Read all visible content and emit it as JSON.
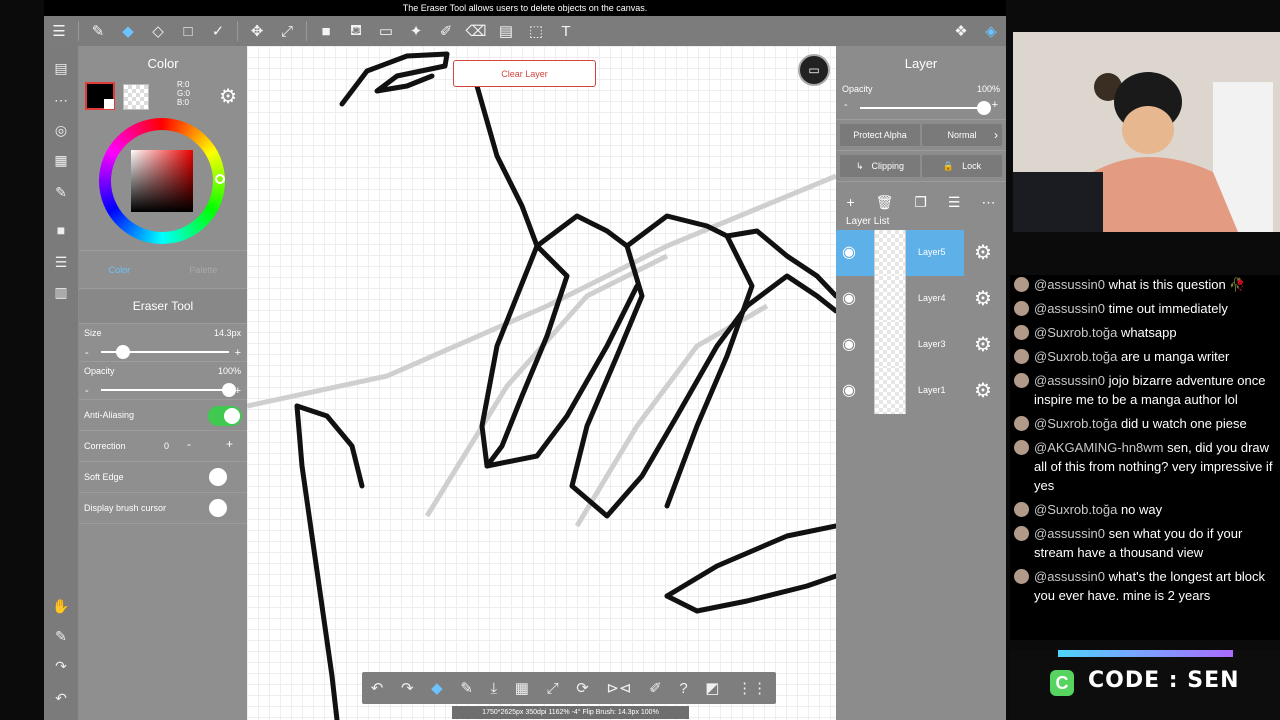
{
  "tooltip": "The Eraser Tool allows users to delete objects on the canvas.",
  "toolbar_top": {
    "left_icons": [
      "menu-icon",
      "brush-icon",
      "eraser-icon",
      "fill-eraser-icon",
      "shape-icon",
      "select-icon"
    ],
    "right_icons": [
      "move-icon",
      "transform-icon",
      "color-square-icon",
      "fill-bucket-icon",
      "gradient-icon",
      "magic-wand-icon",
      "pen-select-icon",
      "eraser-select-icon",
      "layout-icon",
      "lasso-icon",
      "text-icon",
      "materials-icon",
      "layers-icon"
    ],
    "glyphs": {
      "menu": "☰",
      "brush": "✎",
      "eraser": "◆",
      "fill_eraser": "◇",
      "shape": "□",
      "select": "✓",
      "move": "✥",
      "transform": "⤢",
      "color_square": "■",
      "fill": "⛾",
      "gradient": "▭",
      "wand": "✦",
      "pen_select": "✐",
      "eraser_select": "⌫",
      "layout": "▤",
      "lasso": "⬚",
      "text": "T",
      "materials": "❖",
      "layers": "◈"
    }
  },
  "tool_column": {
    "glyphs": [
      "▤",
      "⋯",
      "◎",
      "▦",
      "✎",
      "■",
      "☰",
      "▥",
      "✋",
      "✎",
      "↷",
      "↶"
    ]
  },
  "color_panel": {
    "title": "Color",
    "rgb_r": "R:0",
    "rgb_g": "G:0",
    "rgb_b": "B:0",
    "tab_color": "Color",
    "tab_palette": "Palette",
    "colors": {
      "main": "#000000",
      "sub": "#ffffff",
      "hue": "#ee0000"
    }
  },
  "eraser_panel": {
    "title": "Eraser Tool",
    "size_label": "Size",
    "size_value": "14.3px",
    "size_level": 0.17,
    "opacity_label": "Opacity",
    "opacity_value": "100%",
    "opacity_level": 1.0,
    "anti_aliasing_label": "Anti-Aliasing",
    "anti_aliasing_on": true,
    "correction_label": "Correction",
    "correction_value": "0",
    "soft_edge_label": "Soft Edge",
    "display_cursor_label": "Display brush cursor",
    "minus": "-",
    "plus": "+"
  },
  "canvas": {
    "clear_layer_label": "Clear Layer"
  },
  "layer_panel": {
    "title": "Layer",
    "opacity_label": "Opacity",
    "opacity_value": "100%",
    "opacity_level": 1.0,
    "protect_alpha_label": "Protect Alpha",
    "blend_label": "Normal",
    "clipping_label": "Clipping",
    "lock_label": "Lock",
    "list_title": "Layer List",
    "layers": [
      {
        "name": "Layer5",
        "selected": true
      },
      {
        "name": "Layer4",
        "selected": false
      },
      {
        "name": "Layer3",
        "selected": false
      },
      {
        "name": "Layer1",
        "selected": false
      }
    ],
    "accent": "#5eb0e8"
  },
  "bottom_bar": {
    "glyphs": [
      "↶",
      "↷",
      "◆",
      "✎",
      "⤓",
      "▦",
      "⤢",
      "⟳",
      "⊳⊲",
      "✐",
      "?",
      "◩",
      "⋮⋮"
    ],
    "status": "1750*2625px 350dpi 1162% -4° Flip Brush: 14.3px 100%"
  },
  "chat": {
    "messages": [
      {
        "user": "@assussin0",
        "text": "what is this question 🥀"
      },
      {
        "user": "@assussin0",
        "text": "time out immediately"
      },
      {
        "user": "@Suxrob.toğa",
        "text": "whatsapp"
      },
      {
        "user": "@Suxrob.toğa",
        "text": "are u manga writer"
      },
      {
        "user": "@assussin0",
        "text": "jojo bizarre adventure once inspire me to be a manga author lol"
      },
      {
        "user": "@Suxrob.toğa",
        "text": "did u watch one piese"
      },
      {
        "user": "@AKGAMING-hn8wm",
        "text": "sen, did you draw all of this from nothing? very impressive if yes"
      },
      {
        "user": "@Suxrob.toğa",
        "text": "no way"
      },
      {
        "user": "@assussin0",
        "text": "sen what you do if your stream have a thousand view"
      },
      {
        "user": "@assussin0",
        "text": "what's the longest art block you ever have. mine is 2 years"
      }
    ]
  },
  "code_banner": {
    "logo": "C",
    "text": "CODE : SEN"
  }
}
